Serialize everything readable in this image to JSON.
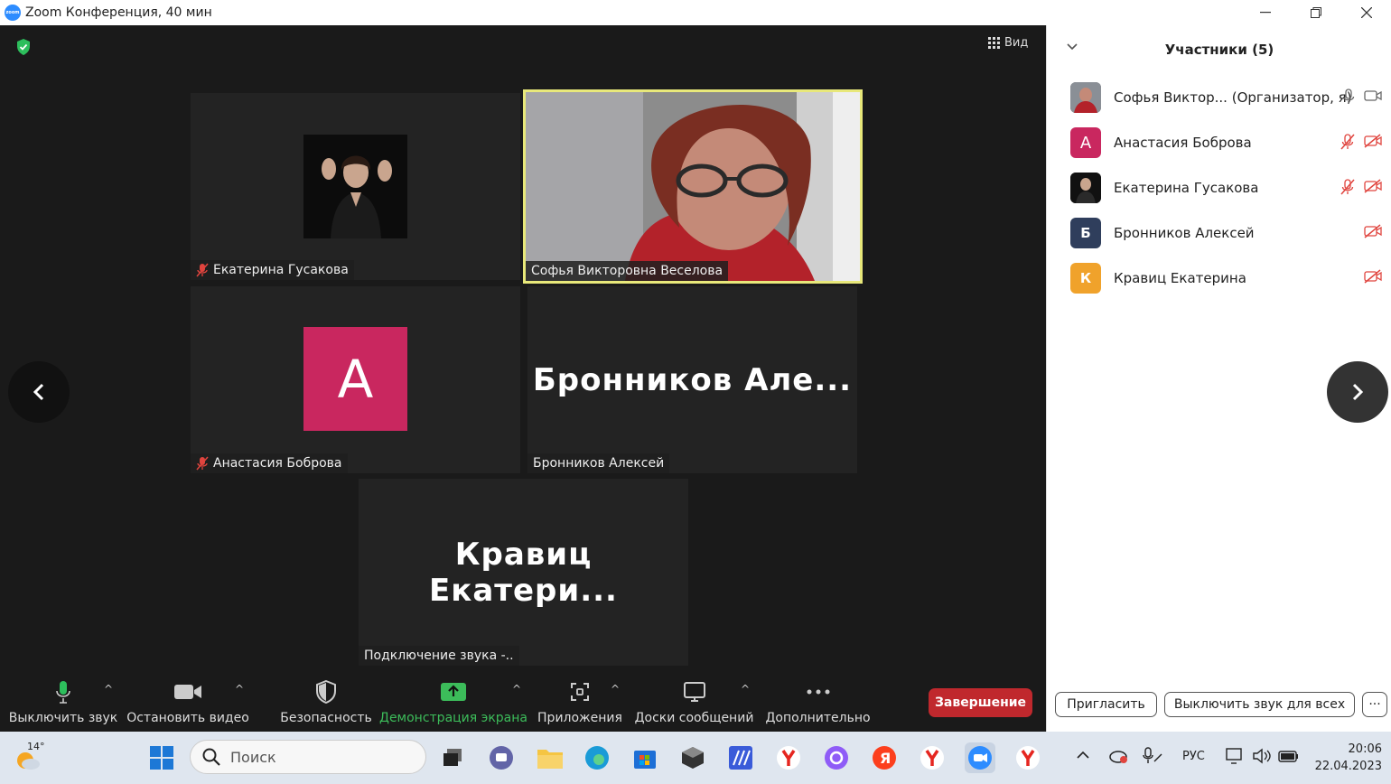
{
  "window": {
    "title": "Zoom Конференция, 40 мин",
    "logo_text": "zoom"
  },
  "meeting": {
    "view_label": "Вид",
    "tiles": [
      {
        "name": "Екатерина Гусакова"
      },
      {
        "name": "Софья Викторовна Веселова"
      },
      {
        "name": "Анастасия Боброва",
        "avatar_letter": "А",
        "avatar_color": "#c9275f"
      },
      {
        "name": "Бронников Алексей",
        "big_name": "Бронников  Але..."
      },
      {
        "name": "Подключение звука -..",
        "big_name": "Кравиц  Екатери..."
      }
    ]
  },
  "toolbar": {
    "mute": "Выключить звук",
    "video": "Остановить видео",
    "security": "Безопасность",
    "share": "Демонстрация экрана",
    "apps": "Приложения",
    "whiteboards": "Доски сообщений",
    "more": "Дополнительно",
    "end": "Завершение",
    "share_color": "#3cbc5a",
    "end_color": "#c0282d"
  },
  "participants": {
    "title": "Участники (5)",
    "list": [
      {
        "name": "Софья Виктор... (Организатор, я)",
        "avatar_letter": "",
        "avatar_color": "#555555"
      },
      {
        "name": "Анастасия Боброва",
        "avatar_letter": "А",
        "avatar_color": "#c9275f"
      },
      {
        "name": "Екатерина Гусакова",
        "avatar_letter": "",
        "avatar_color": "#333333"
      },
      {
        "name": "Бронников Алексей",
        "avatar_letter": "Б",
        "avatar_color": "#2f3e5c"
      },
      {
        "name": "Кравиц Екатерина",
        "avatar_letter": "К",
        "avatar_color": "#f0a22b"
      }
    ],
    "invite": "Пригласить",
    "mute_all": "Выключить звук для всех",
    "more": "···"
  },
  "taskbar": {
    "weather": "14°",
    "search_placeholder": "Поиск",
    "lang": "РУС",
    "time": "20:06",
    "date": "22.04.2023"
  }
}
